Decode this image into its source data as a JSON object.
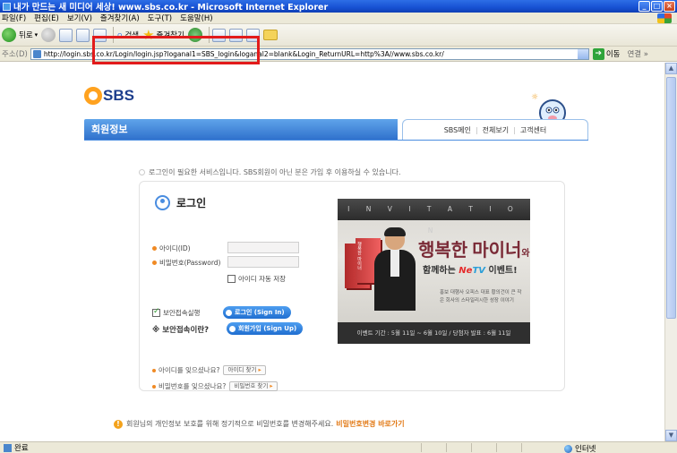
{
  "window": {
    "title": "내가 만드는 새 미디어 세상! www.sbs.co.kr - Microsoft Internet Explorer"
  },
  "menu": [
    "파일(F)",
    "편집(E)",
    "보기(V)",
    "즐겨찾기(A)",
    "도구(T)",
    "도움말(H)"
  ],
  "toolbar": {
    "back": "뒤로",
    "search": "검색",
    "favorites": "즐겨찾기"
  },
  "address": {
    "label": "주소(D)",
    "url": "http://login.sbs.co.kr/Login/login.jsp?loganal1=SBS_login&loganal2=blank&Login_ReturnURL=http%3A//www.sbs.co.kr/",
    "go": "이동",
    "links": "연결 »"
  },
  "page": {
    "logo": "SBS",
    "section_title": "회원정보",
    "header_links": [
      "SBS메인",
      "전체보기",
      "고객센터"
    ],
    "notice": "로그인이 필요한 서비스입니다. SBS회원이 아닌 분은 가입 후 이용하실 수 있습니다.",
    "login_title": "로그인",
    "id_label": "아이디(ID)",
    "pw_label": "비밀번호(Password)",
    "save_id": "아이디 자동 저장",
    "secure_login": "보안접속실행",
    "secure_question": "※ 보안접속이란?",
    "login_btn": "로그인 (Sign In)",
    "join_btn": "회원가입 (Sign Up)",
    "find_id_q": "아이디를 잊으셨나요?",
    "find_id_btn": "아이디 찾기",
    "find_pw_q": "비밀번호를 잊으셨나요?",
    "find_pw_btn": "비밀번호 찾기",
    "banner": {
      "top": "I N V I T A T I O N",
      "book_text": "행복한 마이너",
      "title": "행복한 마이너",
      "title_suffix": "와",
      "sub_pre": "함께하는 ",
      "sub_ne": "Ne",
      "sub_tv": "TV",
      "sub_post": " 이벤트!",
      "desc": "홍보 대행사 오피스 대표 황의건이 큰 작은 회사의 스타일리시한 성장 이야기",
      "foot": "이벤트 기간 : 5월 11일 ~ 6월 10일 / 당첨자 발표 : 6월 11일"
    },
    "privacy": "회원님의 개인정보 보호를 위해 정기적으로 비밀번호를 변경해주세요.",
    "privacy_link": "비밀번호변경 바로가기"
  },
  "status": {
    "left": "완료",
    "zone": "인터넷"
  }
}
